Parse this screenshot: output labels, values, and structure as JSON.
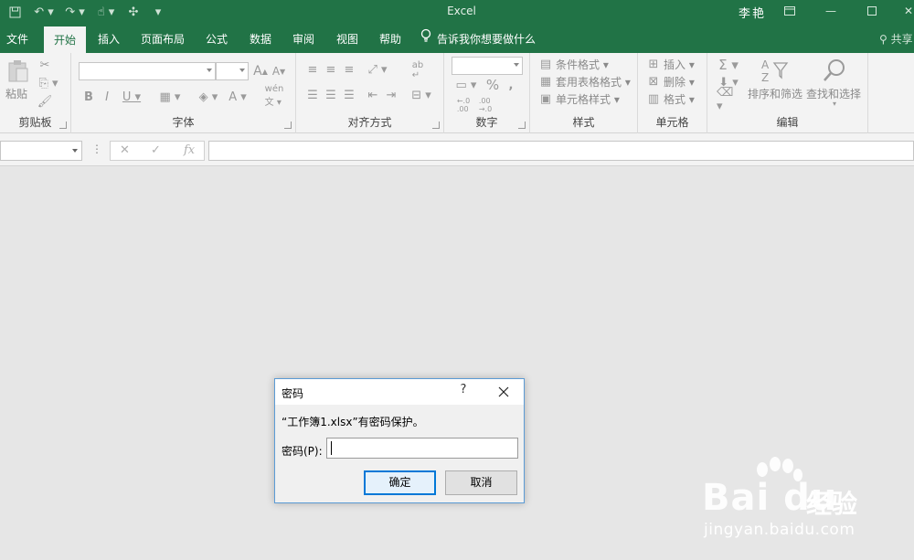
{
  "window": {
    "title": "Excel",
    "user": "李艳"
  },
  "tabs": [
    {
      "label": "文件"
    },
    {
      "label": "开始"
    },
    {
      "label": "插入"
    },
    {
      "label": "页面布局"
    },
    {
      "label": "公式"
    },
    {
      "label": "数据"
    },
    {
      "label": "审阅"
    },
    {
      "label": "视图"
    },
    {
      "label": "帮助"
    }
  ],
  "tell_me": "告诉我你想要做什么",
  "share": "共享",
  "ribbon": {
    "clipboard": {
      "label": "剪贴板",
      "paste": "粘贴"
    },
    "font": {
      "label": "字体"
    },
    "alignment": {
      "label": "对齐方式"
    },
    "number": {
      "label": "数字"
    },
    "styles": {
      "label": "样式",
      "conditional": "条件格式",
      "table": "套用表格格式",
      "cell": "单元格样式"
    },
    "cells": {
      "label": "单元格",
      "insert": "插入",
      "delete": "删除",
      "format": "格式"
    },
    "editing": {
      "label": "编辑",
      "sort": "排序和筛选",
      "find": "查找和选择"
    }
  },
  "dialog": {
    "title": "密码",
    "help": "?",
    "message": "“工作簿1.xlsx”有密码保护。",
    "password_label": "密码(P):",
    "password_value": "",
    "ok": "确定",
    "cancel": "取消"
  },
  "watermark": {
    "brand": "Bai du",
    "suffix": "经验",
    "url": "jingyan.baidu.com"
  },
  "colors": {
    "accent": "#217346",
    "dialog_border": "#5b9bd5",
    "default_button": "#0078d7"
  }
}
